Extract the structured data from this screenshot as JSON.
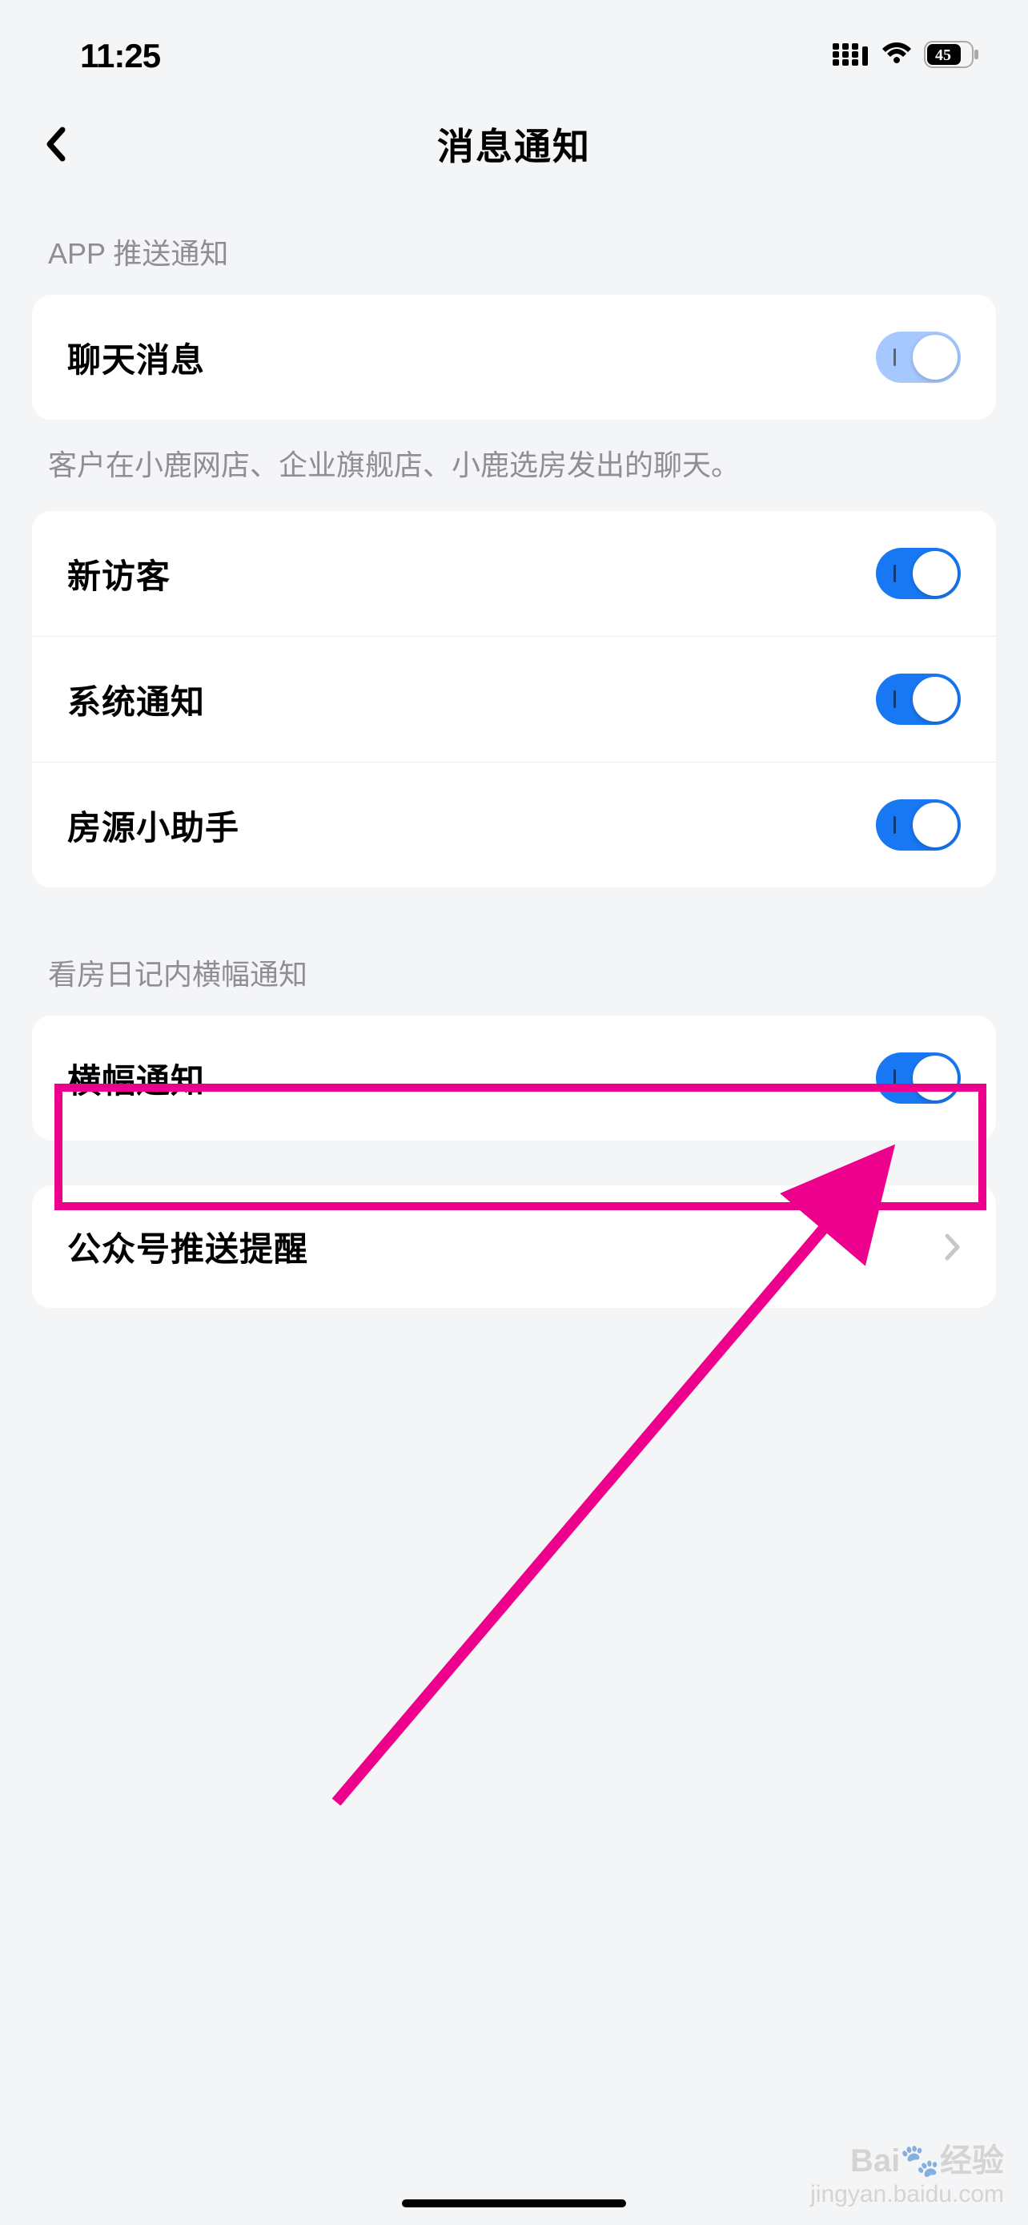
{
  "status": {
    "time": "11:25",
    "battery": "45"
  },
  "nav": {
    "title": "消息通知"
  },
  "section1": {
    "heading": "APP 推送通知",
    "rows": [
      {
        "label": "聊天消息",
        "toggle": "on-light"
      }
    ],
    "footer": "客户在小鹿网店、企业旗舰店、小鹿选房发出的聊天。"
  },
  "section2": {
    "rows": [
      {
        "label": "新访客",
        "toggle": "on"
      },
      {
        "label": "系统通知",
        "toggle": "on"
      },
      {
        "label": "房源小助手",
        "toggle": "on"
      }
    ]
  },
  "section3": {
    "heading": "看房日记内横幅通知",
    "rows": [
      {
        "label": "横幅通知",
        "toggle": "on"
      }
    ]
  },
  "section4": {
    "rows": [
      {
        "label": "公众号推送提醒",
        "nav": true
      }
    ]
  },
  "watermark": {
    "brand": "Bai",
    "brand2": "经验",
    "sub": "jingyan.baidu.com"
  }
}
